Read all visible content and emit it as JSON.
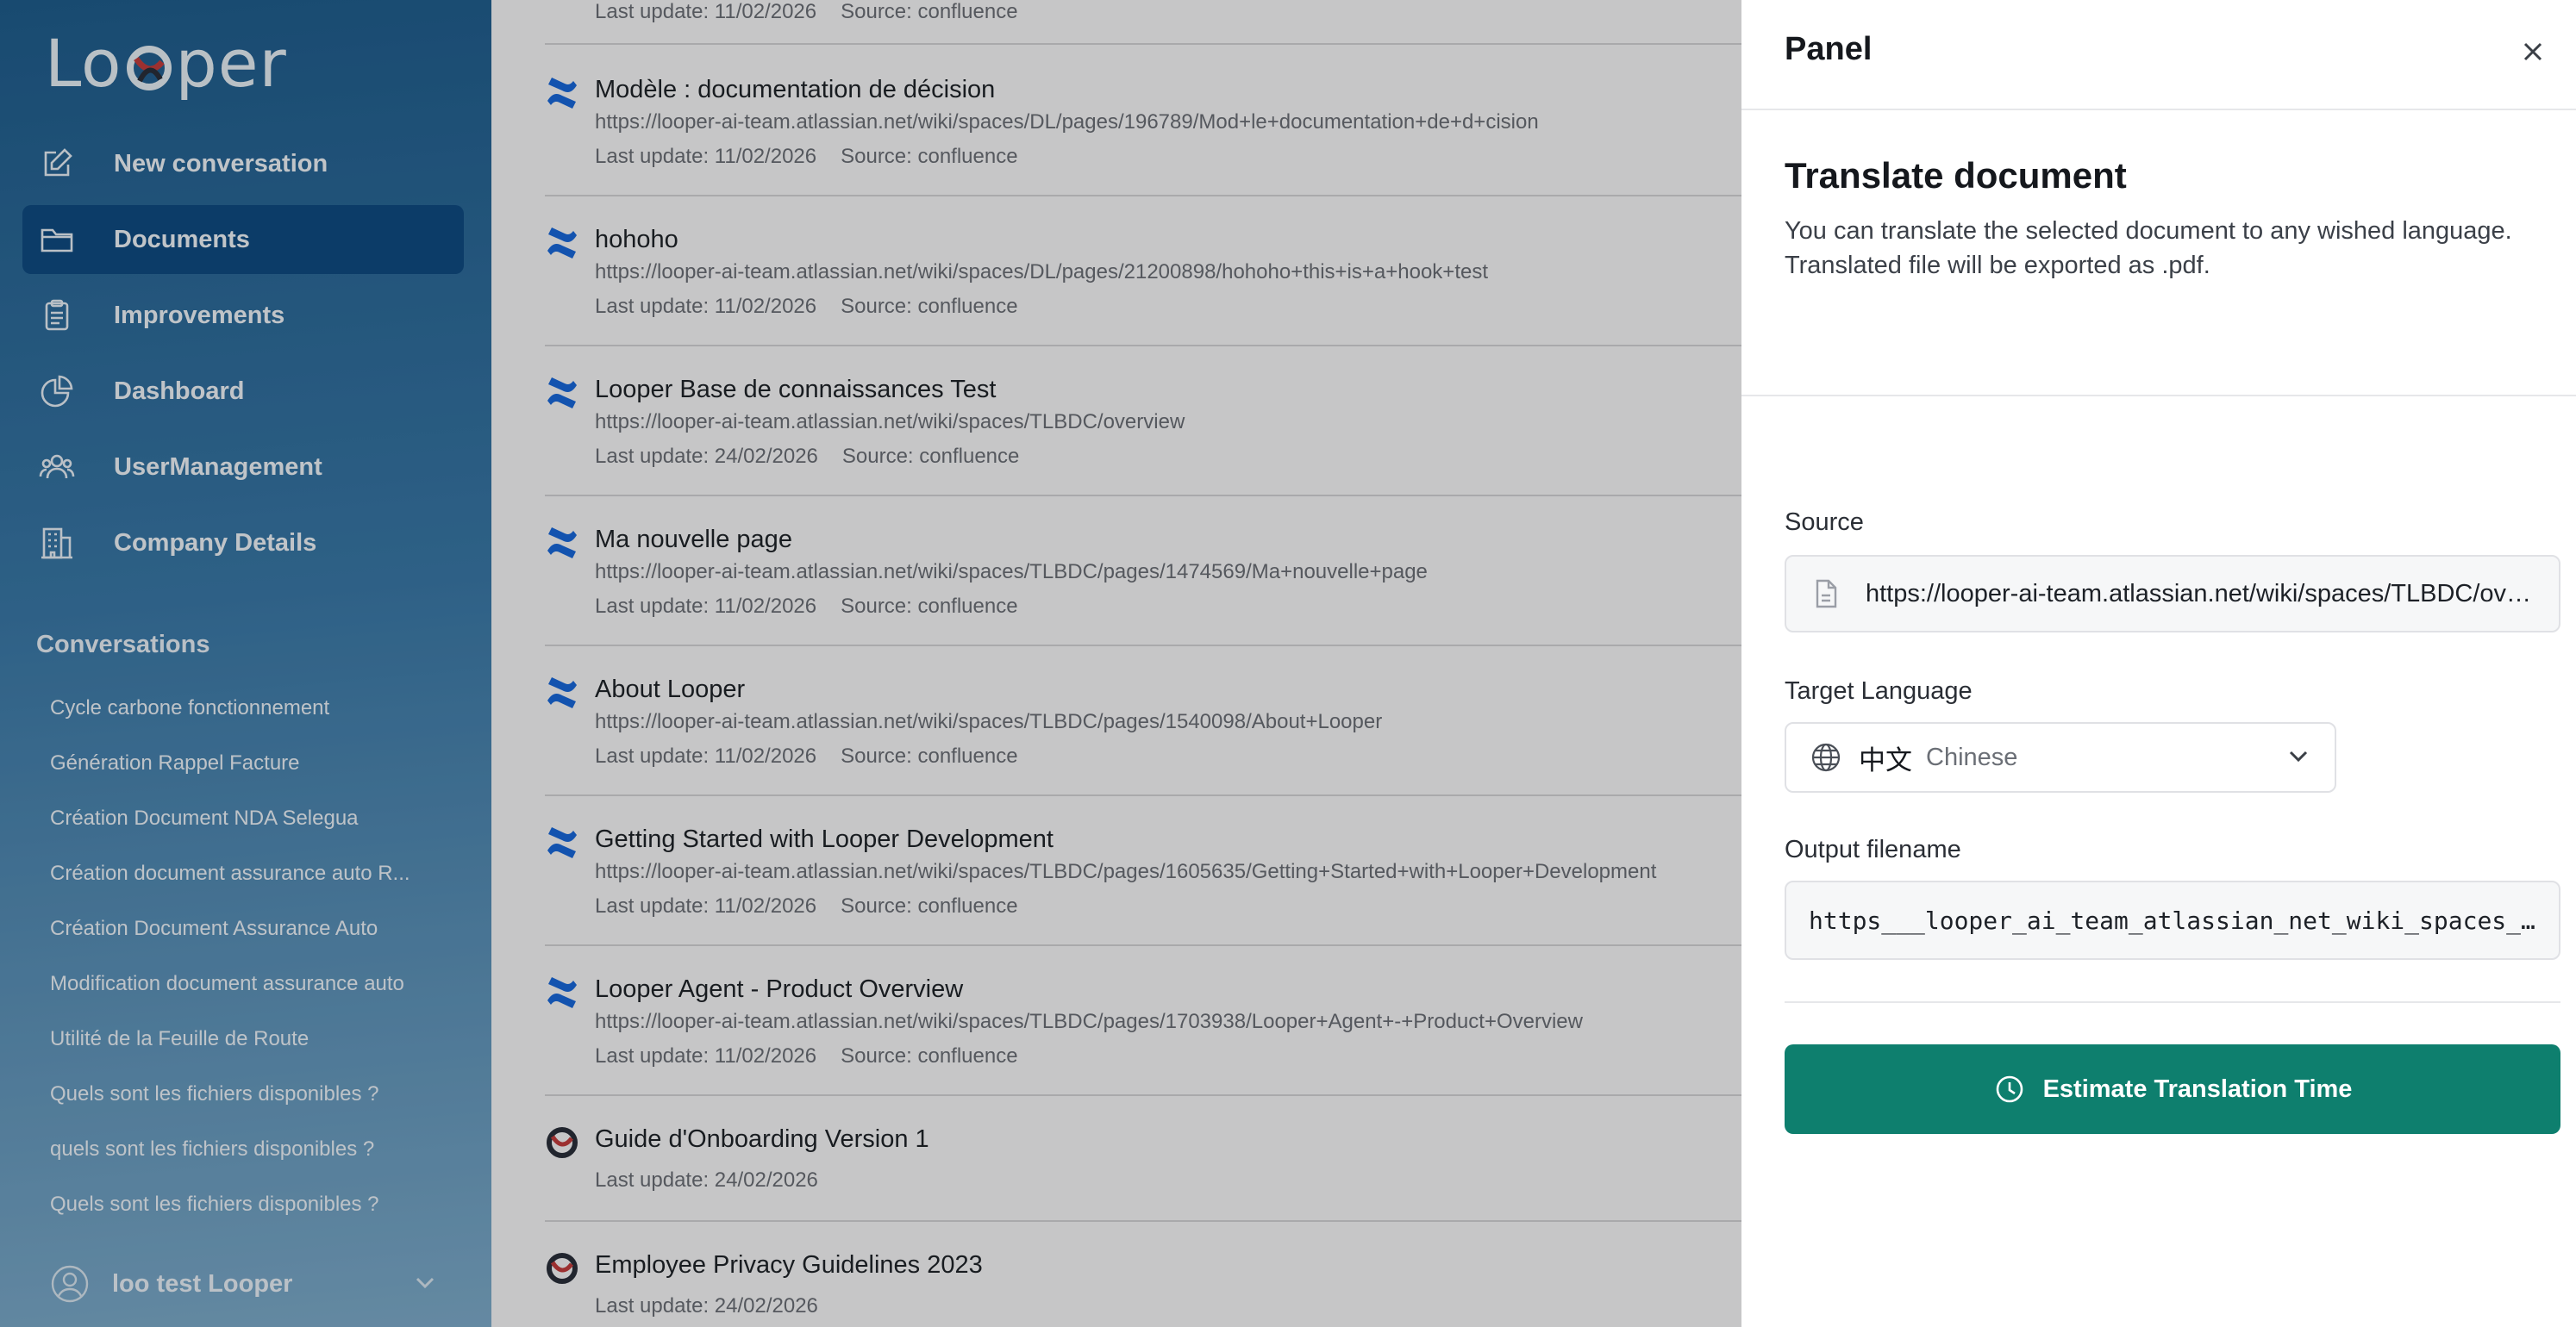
{
  "app": {
    "logo_text_left": "Lo",
    "logo_text_right": "per"
  },
  "nav": [
    {
      "label": "New conversation",
      "icon": "pencil-square-icon"
    },
    {
      "label": "Documents",
      "icon": "folder-icon",
      "active": true
    },
    {
      "label": "Improvements",
      "icon": "clipboard-icon"
    },
    {
      "label": "Dashboard",
      "icon": "pie-chart-icon"
    },
    {
      "label": "UserManagement",
      "icon": "users-icon"
    },
    {
      "label": "Company Details",
      "icon": "building-icon"
    }
  ],
  "conversations": {
    "title": "Conversations",
    "items": [
      "Cycle carbone fonctionnement",
      "Génération Rappel Facture",
      "Création Document NDA Selegua",
      "Création document assurance auto R...",
      "Création Document Assurance Auto",
      "Modification document assurance auto",
      "Utilité de la Feuille de Route",
      "Quels sont les fichiers disponibles ?",
      "quels sont les fichiers disponibles ?",
      "Quels sont les fichiers disponibles ?"
    ]
  },
  "user": {
    "name": "loo test Looper"
  },
  "documents": [
    {
      "title": "",
      "url": "",
      "update": "Last update: 11/02/2026",
      "source": "Source: confluence",
      "icon": "confluence-icon"
    },
    {
      "title": "Modèle : documentation de décision",
      "url": "https://looper-ai-team.atlassian.net/wiki/spaces/DL/pages/196789/Mod+le+documentation+de+d+cision",
      "update": "Last update: 11/02/2026",
      "source": "Source: confluence",
      "icon": "confluence-icon"
    },
    {
      "title": "hohoho",
      "url": "https://looper-ai-team.atlassian.net/wiki/spaces/DL/pages/21200898/hohoho+this+is+a+hook+test",
      "update": "Last update: 11/02/2026",
      "source": "Source: confluence",
      "icon": "confluence-icon"
    },
    {
      "title": "Looper Base de connaissances Test",
      "url": "https://looper-ai-team.atlassian.net/wiki/spaces/TLBDC/overview",
      "update": "Last update: 24/02/2026",
      "source": "Source: confluence",
      "icon": "confluence-icon"
    },
    {
      "title": "Ma nouvelle page",
      "url": "https://looper-ai-team.atlassian.net/wiki/spaces/TLBDC/pages/1474569/Ma+nouvelle+page",
      "update": "Last update: 11/02/2026",
      "source": "Source: confluence",
      "icon": "confluence-icon"
    },
    {
      "title": "About Looper",
      "url": "https://looper-ai-team.atlassian.net/wiki/spaces/TLBDC/pages/1540098/About+Looper",
      "update": "Last update: 11/02/2026",
      "source": "Source: confluence",
      "icon": "confluence-icon"
    },
    {
      "title": "Getting Started with Looper Development",
      "url": "https://looper-ai-team.atlassian.net/wiki/spaces/TLBDC/pages/1605635/Getting+Started+with+Looper+Development",
      "update": "Last update: 11/02/2026",
      "source": "Source: confluence",
      "icon": "confluence-icon"
    },
    {
      "title": "Looper Agent - Product Overview",
      "url": "https://looper-ai-team.atlassian.net/wiki/spaces/TLBDC/pages/1703938/Looper+Agent+-+Product+Overview",
      "update": "Last update: 11/02/2026",
      "source": "Source: confluence",
      "icon": "confluence-icon"
    },
    {
      "title": "Guide d'Onboarding Version 1",
      "url": "",
      "update": "Last update: 24/02/2026",
      "source": "",
      "icon": "looper-icon"
    },
    {
      "title": "Employee Privacy Guidelines 2023",
      "url": "",
      "update": "Last update: 24/02/2026",
      "source": "",
      "icon": "looper-icon"
    }
  ],
  "panel": {
    "title": "Panel",
    "section_title": "Translate document",
    "description": "You can translate the selected document to any wished language. Translated file will be exported as .pdf.",
    "source_label": "Source",
    "source_value": "https://looper-ai-team.atlassian.net/wiki/spaces/TLBDC/overview",
    "target_label": "Target Language",
    "target_native": "中文",
    "target_english": "Chinese",
    "output_label": "Output filename",
    "output_value": "https___looper_ai_team_atlassian_net_wiki_spaces_TLBDC_overview",
    "button_label": "Estimate Translation Time"
  },
  "colors": {
    "accent": "#0e7f6e",
    "sidebar_active": "#0f4c82",
    "confluence": "#1868db"
  }
}
